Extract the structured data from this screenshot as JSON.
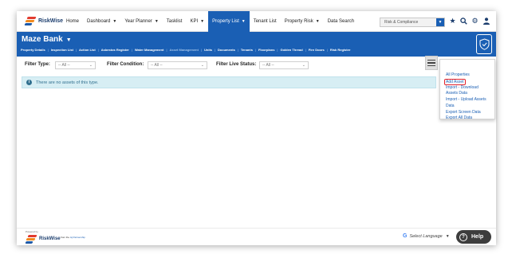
{
  "brand": {
    "name": "RiskWise"
  },
  "nav": {
    "items": [
      {
        "label": "Home",
        "dropdown": false,
        "active": false,
        "name": "nav-home"
      },
      {
        "label": "Dashboard",
        "dropdown": true,
        "active": false,
        "name": "nav-dashboard"
      },
      {
        "label": "Year Planner",
        "dropdown": true,
        "active": false,
        "name": "nav-year-planner"
      },
      {
        "label": "Tasklist",
        "dropdown": false,
        "active": false,
        "name": "nav-tasklist"
      },
      {
        "label": "KPI",
        "dropdown": true,
        "active": false,
        "name": "nav-kpi"
      },
      {
        "label": "Property List",
        "dropdown": true,
        "active": true,
        "name": "nav-property-list"
      },
      {
        "label": "Tenant List",
        "dropdown": false,
        "active": false,
        "name": "nav-tenant-list"
      },
      {
        "label": "Property Risk",
        "dropdown": true,
        "active": false,
        "name": "nav-property-risk"
      },
      {
        "label": "Data Search",
        "dropdown": false,
        "active": false,
        "name": "nav-data-search"
      }
    ],
    "role_select": "Risk & Compliance",
    "icons": [
      "star-icon",
      "search-icon",
      "gear-icon",
      "user-icon"
    ]
  },
  "header": {
    "title": "Maze Bank",
    "subnav": [
      {
        "label": "Property Details",
        "dim": false
      },
      {
        "label": "Inspection List",
        "dim": false
      },
      {
        "label": "Action List",
        "dim": false
      },
      {
        "label": "Asbestos Register",
        "dim": false
      },
      {
        "label": "Water Management",
        "dim": false
      },
      {
        "label": "Asset Management",
        "dim": true
      },
      {
        "label": "Units",
        "dim": false
      },
      {
        "label": "Documents",
        "dim": false
      },
      {
        "label": "Tenants",
        "dim": false
      },
      {
        "label": "Floorplans",
        "dim": false
      },
      {
        "label": "Golden Thread",
        "dim": false
      },
      {
        "label": "Fire Doors",
        "dim": false
      },
      {
        "label": "Risk Register",
        "dim": false
      }
    ]
  },
  "filters": {
    "type_label": "Filter Type:",
    "type_value": "-- All --",
    "condition_label": "Filter Condition:",
    "condition_value": "-- All --",
    "live_label": "Filter Live Status:",
    "live_value": "-- All --"
  },
  "alert": {
    "text": "There are no assets of this type."
  },
  "dropdown_menu": {
    "items": [
      {
        "label": "All Properties",
        "highlight": false
      },
      {
        "label": "Add Asset",
        "highlight": true
      },
      {
        "label": "Import - Download",
        "highlight": false
      },
      {
        "label": "Assets Data",
        "highlight": false
      },
      {
        "label": "Import - Upload Assets",
        "highlight": false
      },
      {
        "label": "Data",
        "highlight": false
      },
      {
        "label": "Export Screen Data",
        "highlight": false
      },
      {
        "label": "Export All Data",
        "highlight": false
      }
    ]
  },
  "footer": {
    "powered_by": "Powered by",
    "from_the": "from the",
    "partnership": "&j Partnership",
    "translate": "Select Language",
    "help": "Help"
  }
}
